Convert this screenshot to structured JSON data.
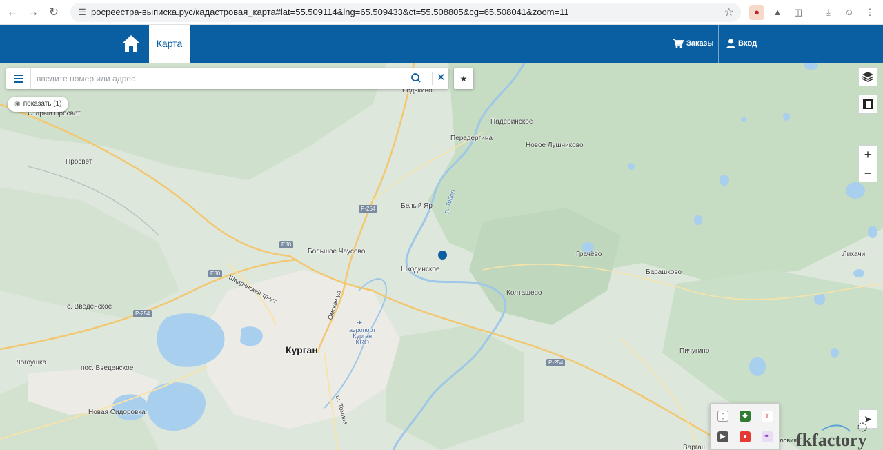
{
  "browser": {
    "url": "росреестра-выписка.рус/кадастровая_карта#lat=55.509114&lng=65.509433&ct=55.508805&cg=65.508041&zoom=11"
  },
  "header": {
    "map_tab": "Карта",
    "orders": "Заказы",
    "login": "Вход"
  },
  "search": {
    "placeholder": "введите номер или адрес"
  },
  "show_button": "показать (1)",
  "map_labels": {
    "redkino": "Редькино",
    "stary_prosvet": "Старый Просвет",
    "paderinskoe": "Падеринское",
    "peredergina": "Передергина",
    "novoe_lushnikovo": "Новое Лушниково",
    "prosvet": "Просвет",
    "bely_yar": "Белый Яр",
    "tobol": "р. Тобол",
    "bolshoe_chausovo": "Большое Чаусово",
    "grachevo": "Грачёво",
    "shkodinskoe": "Шкодинское",
    "lihachi": "Лихачи",
    "barashkovo": "Барашково",
    "koltashevo": "Колташево",
    "vvedenskoe": "с. Введенское",
    "shadrinsky_trakt": "Шадринский тракт",
    "omskaya": "Омская ул.",
    "airport": "аэропорт\nКурган\nKRO",
    "kurgan": "Курган",
    "pichugino": "Пичугино",
    "logoushka": "Логоушка",
    "pos_vvedenskoe": "пос. Введенское",
    "novaya_sidorovka": "Новая Сидоровка",
    "tomina": "ш. Томина",
    "vargashi": "Варгаш"
  },
  "road_signs": {
    "r254_a": "Р-254",
    "e30_a": "E30",
    "e30_b": "E30",
    "r254_b": "Р-254",
    "r254_c": "Р-254"
  },
  "footer_text": "ловия",
  "watermark": "fkfactory"
}
